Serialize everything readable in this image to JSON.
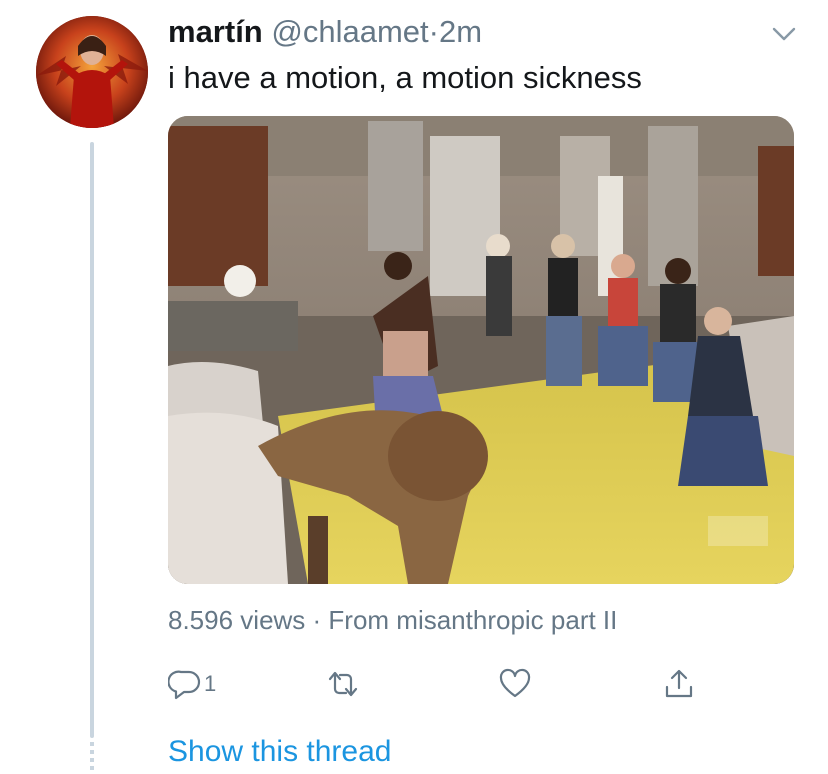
{
  "tweet": {
    "display_name": "martín",
    "handle": "@chlaamet",
    "separator": "·",
    "time": "2m",
    "text": "i have a motion, a motion sickness",
    "views_text": "8.596 views · From misanthropic part II",
    "reply_count": "1",
    "show_thread": "Show this thread"
  },
  "icons": {
    "menu": "chevron-down-icon",
    "reply": "reply-bubble-icon",
    "retweet": "retweet-icon",
    "like": "heart-icon",
    "share": "share-icon"
  },
  "colors": {
    "link": "#1b95e0",
    "secondary_text": "#657786",
    "primary_text": "#14171a",
    "thread_line": "#c9d5df"
  }
}
